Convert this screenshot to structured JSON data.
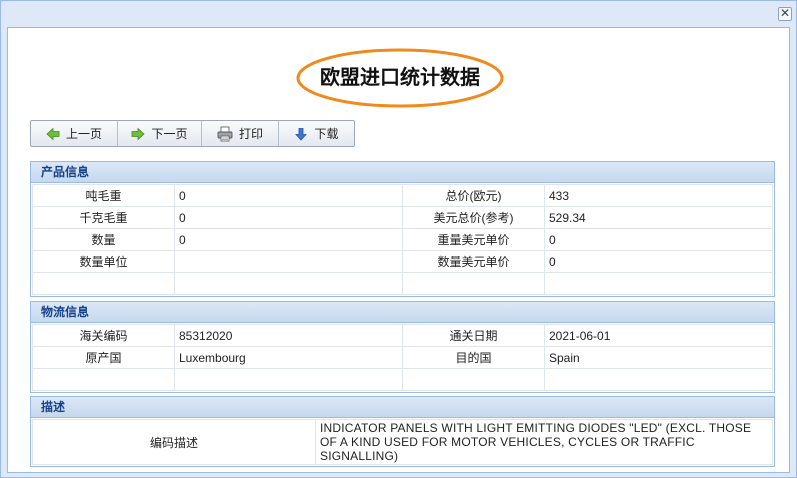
{
  "window": {
    "close_glyph": "✕"
  },
  "title": "欧盟进口统计数据",
  "colors": {
    "highlight_ellipse": "#f08a1c",
    "section_title": "#15428b",
    "panel_border": "#99bbe8"
  },
  "toolbar": {
    "prev_label": "上一页",
    "next_label": "下一页",
    "print_label": "打印",
    "download_label": "下载",
    "icons": {
      "prev": "arrow-left-icon",
      "next": "arrow-right-icon",
      "print": "printer-icon",
      "download": "arrow-down-icon"
    }
  },
  "product": {
    "header": "产品信息",
    "rows": [
      {
        "l1": "吨毛重",
        "v1": "0",
        "l2": "总价(欧元)",
        "v2": "433"
      },
      {
        "l1": "千克毛重",
        "v1": "0",
        "l2": "美元总价(参考)",
        "v2": "529.34"
      },
      {
        "l1": "数量",
        "v1": "0",
        "l2": "重量美元单价",
        "v2": "0"
      },
      {
        "l1": "数量单位",
        "v1": "",
        "l2": "数量美元单价",
        "v2": "0"
      }
    ]
  },
  "logistics": {
    "header": "物流信息",
    "rows": [
      {
        "l1": "海关编码",
        "v1": "85312020",
        "l2": "通关日期",
        "v2": "2021-06-01"
      },
      {
        "l1": "原产国",
        "v1": "Luxembourg",
        "l2": "目的国",
        "v2": "Spain"
      }
    ]
  },
  "description": {
    "header": "描述",
    "label": "编码描述",
    "value": "INDICATOR PANELS WITH LIGHT EMITTING DIODES \"LED\" (EXCL. THOSE OF A KIND USED FOR MOTOR VEHICLES, CYCLES OR TRAFFIC SIGNALLING)"
  }
}
